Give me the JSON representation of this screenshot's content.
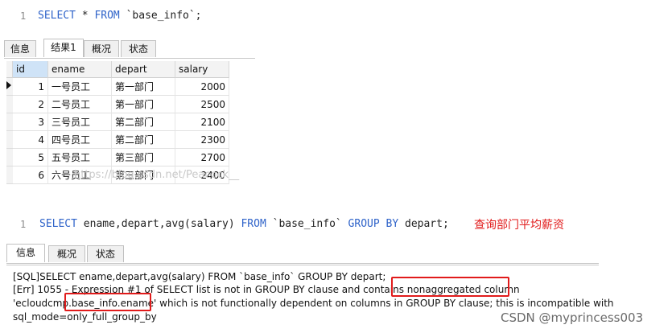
{
  "query1": {
    "line_no": "1",
    "tokens": [
      {
        "t": "SELECT",
        "k": true
      },
      {
        "t": " * ",
        "k": false
      },
      {
        "t": "FROM",
        "k": true
      },
      {
        "t": " `base_info`;",
        "k": false
      }
    ]
  },
  "tabs1": [
    "信息",
    "结果1",
    "概况",
    "状态"
  ],
  "grid": {
    "columns": [
      "id",
      "ename",
      "depart",
      "salary"
    ],
    "rows": [
      [
        "1",
        "一号员工",
        "第一部门",
        "2000"
      ],
      [
        "2",
        "二号员工",
        "第一部门",
        "2500"
      ],
      [
        "3",
        "三号员工",
        "第二部门",
        "2100"
      ],
      [
        "4",
        "四号员工",
        "第二部门",
        "2300"
      ],
      [
        "5",
        "五号员工",
        "第三部门",
        "2700"
      ],
      [
        "6",
        "六号员工",
        "第三部门",
        "2400"
      ]
    ]
  },
  "watermark1": "https://blog.csdn.net/Peacock__",
  "query2": {
    "line_no": "1",
    "tokens": [
      {
        "t": "SELECT",
        "k": true
      },
      {
        "t": " ename,depart,avg",
        "k": false
      },
      {
        "t": "(salary)",
        "k": false
      },
      {
        "t": " FROM",
        "k": true
      },
      {
        "t": " `base_info` ",
        "k": false
      },
      {
        "t": "GROUP BY",
        "k": true
      },
      {
        "t": " depart;",
        "k": false
      }
    ]
  },
  "annotation": "查询部门平均薪资",
  "tabs2": [
    "信息",
    "概况",
    "状态"
  ],
  "messages": [
    "[SQL]SELECT ename,depart,avg(salary) FROM `base_info` GROUP BY depart;",
    "[Err] 1055 - Expression #1 of SELECT list is not in GROUP BY clause and contains nonaggregated column",
    "'ecloudcmp.base_info.ename' which is not functionally dependent on columns in GROUP BY clause; this is incompatible with",
    "sql_mode=only_full_group_by"
  ],
  "watermark2": "CSDN @myprincess003",
  "colors": {
    "keyword": "#2f63c9",
    "highlight": "#e11b1b",
    "annotation": "#e11b1b"
  }
}
